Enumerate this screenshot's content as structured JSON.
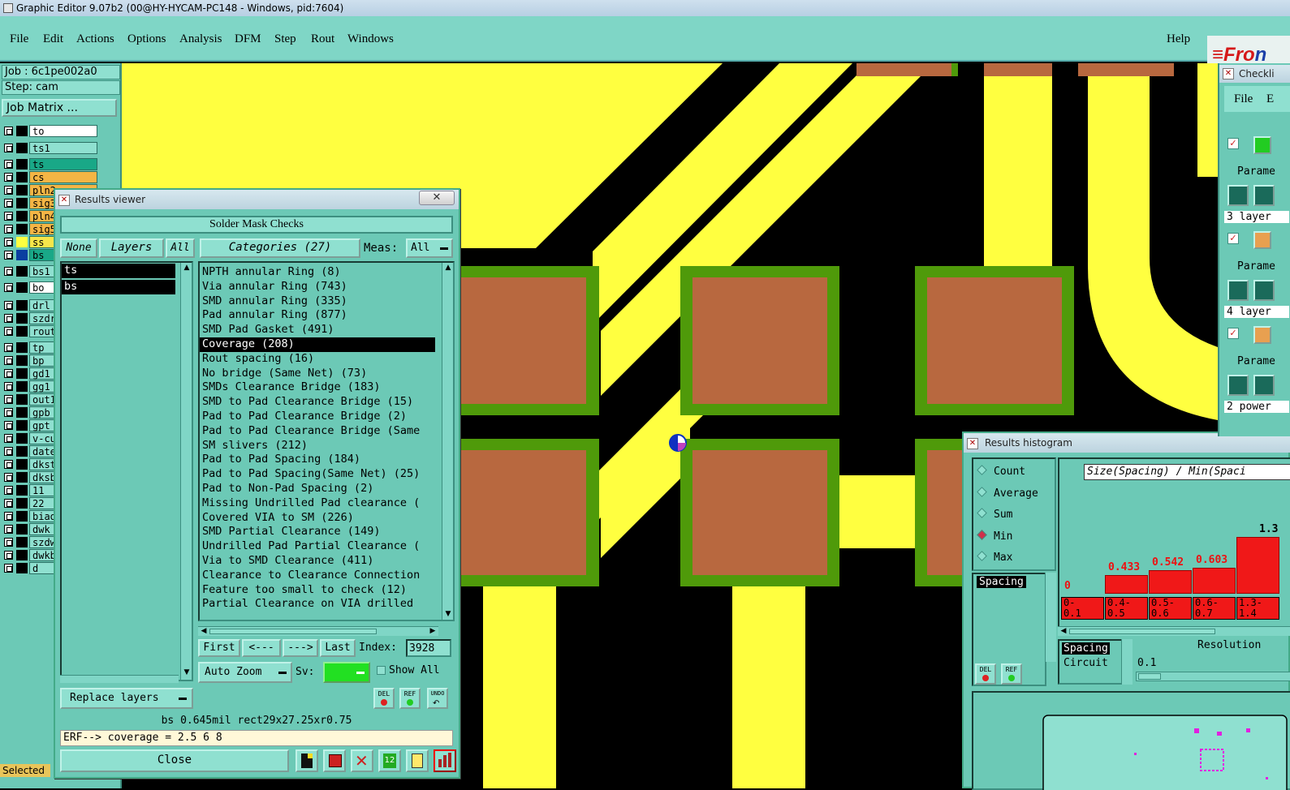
{
  "window": {
    "title": "Graphic Editor 9.07b2 (00@HY-HYCAM-PC148 - Windows, pid:7604)"
  },
  "menu": {
    "items": [
      "File",
      "Edit",
      "Actions",
      "Options",
      "Analysis",
      "DFM",
      "Step",
      "Rout",
      "Windows"
    ],
    "help": "Help",
    "brand": {
      "prefix": "≡Fro",
      "rest": "n"
    }
  },
  "job": {
    "job_line": "Job : 6c1pe002a0",
    "step_line": "Step: cam",
    "matrix_button": "Job Matrix ..."
  },
  "layers": [
    {
      "name": "to",
      "color": "#ffffff",
      "sw": "#000000"
    },
    {
      "name": "ts1",
      "color": "#8fe0d0",
      "sw": "#000000"
    },
    {
      "name": "ts",
      "color": "#19a887",
      "sw": "#000000"
    },
    {
      "name": "cs",
      "color": "#f4b545",
      "sw": "#000000"
    },
    {
      "name": "pln2",
      "color": "#f4b545",
      "sw": "#000000"
    },
    {
      "name": "sig3",
      "color": "#f4b545",
      "sw": "#000000"
    },
    {
      "name": "pln4",
      "color": "#f4b545",
      "sw": "#000000"
    },
    {
      "name": "sig5",
      "color": "#f4b545",
      "sw": "#000000"
    },
    {
      "name": "ss",
      "color": "#f7e64a",
      "sw": "#ffff40"
    },
    {
      "name": "bs",
      "color": "#19a887",
      "sw": "#0b3fa0"
    },
    {
      "name": "bs1",
      "color": "#8fe0d0",
      "sw": "#000000"
    },
    {
      "name": "bo",
      "color": "#ffffff",
      "sw": "#000000"
    },
    {
      "name": "drl",
      "color": "#8fe0d0",
      "sw": "#000000"
    },
    {
      "name": "szdr",
      "color": "#8fe0d0",
      "sw": "#000000"
    },
    {
      "name": "rout",
      "color": "#8fe0d0",
      "sw": "#000000"
    },
    {
      "name": "tp",
      "color": "#8fe0d0",
      "sw": "#000000"
    },
    {
      "name": "bp",
      "color": "#8fe0d0",
      "sw": "#000000"
    },
    {
      "name": "gd1",
      "color": "#8fe0d0",
      "sw": "#000000"
    },
    {
      "name": "gg1",
      "color": "#8fe0d0",
      "sw": "#000000"
    },
    {
      "name": "out1",
      "color": "#8fe0d0",
      "sw": "#000000"
    },
    {
      "name": "gpb",
      "color": "#8fe0d0",
      "sw": "#000000"
    },
    {
      "name": "gpt",
      "color": "#8fe0d0",
      "sw": "#000000"
    },
    {
      "name": "v-cu",
      "color": "#8fe0d0",
      "sw": "#000000"
    },
    {
      "name": "date",
      "color": "#8fe0d0",
      "sw": "#000000"
    },
    {
      "name": "dkst",
      "color": "#8fe0d0",
      "sw": "#000000"
    },
    {
      "name": "dksb",
      "color": "#8fe0d0",
      "sw": "#000000"
    },
    {
      "name": "11",
      "color": "#8fe0d0",
      "sw": "#000000"
    },
    {
      "name": "22",
      "color": "#8fe0d0",
      "sw": "#000000"
    },
    {
      "name": "biao",
      "color": "#8fe0d0",
      "sw": "#000000"
    },
    {
      "name": "dwk",
      "color": "#8fe0d0",
      "sw": "#000000"
    },
    {
      "name": "szdw",
      "color": "#8fe0d0",
      "sw": "#000000"
    },
    {
      "name": "dwkb",
      "color": "#8fe0d0",
      "sw": "#000000"
    },
    {
      "name": "d",
      "color": "#8fe0d0",
      "sw": "#000000"
    }
  ],
  "status_selected": "Selected",
  "results_viewer": {
    "title": "Results viewer",
    "close_x": "✕",
    "header": "Solder Mask Checks",
    "none_btn": "None",
    "layers_btn": "Layers",
    "all_btn": "All",
    "categories_btn": "Categories (27)",
    "meas_label": "Meas:",
    "meas_value": "All",
    "layer_list": [
      "ts",
      "bs"
    ],
    "categories": [
      "NPTH annular Ring (8)",
      "Via annular Ring (743)",
      "SMD annular Ring (335)",
      "Pad annular Ring (877)",
      "SMD Pad Gasket (491)",
      "Coverage (208)",
      "Rout spacing (16)",
      "No bridge (Same Net) (73)",
      "SMDs Clearance Bridge (183)",
      "SMD to Pad Clearance Bridge (15)",
      "Pad to Pad Clearance Bridge (2)",
      "Pad to Pad Clearance Bridge (Same",
      "SM slivers (212)",
      "Pad to Pad Spacing (184)",
      "Pad to Pad Spacing(Same Net) (25)",
      "Pad to Non-Pad Spacing (2)",
      "Missing Undrilled Pad clearance (",
      "Covered VIA to SM (226)",
      "SMD Partial Clearance (149)",
      "Undrilled Pad Partial Clearance (",
      "Via to SMD Clearance (411)",
      "Clearance to Clearance Connection",
      "Feature too small to check (12)",
      "Partial Clearance on VIA drilled"
    ],
    "selected_category": "Coverage (208)",
    "nav": {
      "first": "First",
      "prev": "<---",
      "next": "--->",
      "last": "Last",
      "index_label": "Index:",
      "index_value": "3928"
    },
    "auto_zoom": "Auto Zoom",
    "sv_label": "Sv:",
    "show_all": "Show All",
    "replace_layers": "Replace layers",
    "del": "DEL",
    "ref": "REF",
    "undo": "UNDO",
    "status": "bs 0.645mil  rect29x27.25xr0.75",
    "erf": "ERF--> coverage = 2.5 6 8",
    "close_btn": "Close"
  },
  "histogram": {
    "title": "Results histogram",
    "options": [
      "Count",
      "Average",
      "Sum",
      "Min",
      "Max"
    ],
    "selected_option": "Min",
    "list": [
      "Spacing"
    ],
    "chart_title": "Size(Spacing) / Min(Spaci",
    "bars": [
      {
        "label": "0",
        "cat": "0-\n0.1",
        "value": 0
      },
      {
        "label": "0.433",
        "cat": "0.4-\n0.5",
        "value": 0.433
      },
      {
        "label": "0.542",
        "cat": "0.5-\n0.6",
        "value": 0.542
      },
      {
        "label": "0.603",
        "cat": "0.6-\n0.7",
        "value": 0.603
      },
      {
        "label": "1.3",
        "cat": "1.3-\n1.4",
        "value": 1.3
      }
    ],
    "param_list": [
      "Spacing",
      "Circuit"
    ],
    "resolution_label": "Resolution",
    "resolution_value": "0.1",
    "del": "DEL",
    "ref": "REF"
  },
  "checklist": {
    "title": "Checkli",
    "menu": [
      "File",
      "E"
    ],
    "params_label": "Parame",
    "rows": [
      "3 layer",
      "4 layer",
      "2 power"
    ]
  },
  "colors": {
    "trace": "#ffff40",
    "pad": "#b8683f",
    "mask": "#4f9a0a",
    "panel": "#6cc9b6",
    "panel_light": "#8fe0d0"
  }
}
